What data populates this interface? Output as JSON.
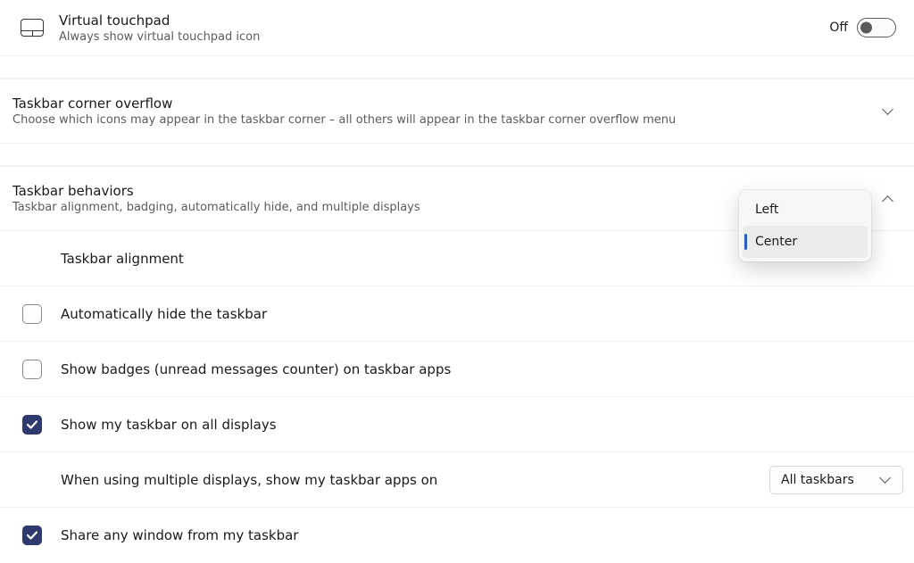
{
  "virtual_touchpad": {
    "title": "Virtual touchpad",
    "subtitle": "Always show virtual touchpad icon",
    "state_label": "Off",
    "on": false
  },
  "overflow": {
    "title": "Taskbar corner overflow",
    "subtitle": "Choose which icons may appear in the taskbar corner – all others will appear in the taskbar corner overflow menu",
    "expanded": false
  },
  "behaviors": {
    "title": "Taskbar behaviors",
    "subtitle": "Taskbar alignment, badging, automatically hide, and multiple displays",
    "expanded": true
  },
  "alignment": {
    "label": "Taskbar alignment",
    "options": [
      "Left",
      "Center"
    ],
    "selected": "Center"
  },
  "opt_autohide": {
    "label": "Automatically hide the taskbar",
    "checked": false
  },
  "opt_badges": {
    "label": "Show badges (unread messages counter) on taskbar apps",
    "checked": false
  },
  "opt_all_displays": {
    "label": "Show my taskbar on all displays",
    "checked": true
  },
  "multi_display": {
    "label": "When using multiple displays, show my taskbar apps on",
    "value": "All taskbars"
  },
  "opt_share_window": {
    "label": "Share any window from my taskbar",
    "checked": true
  }
}
